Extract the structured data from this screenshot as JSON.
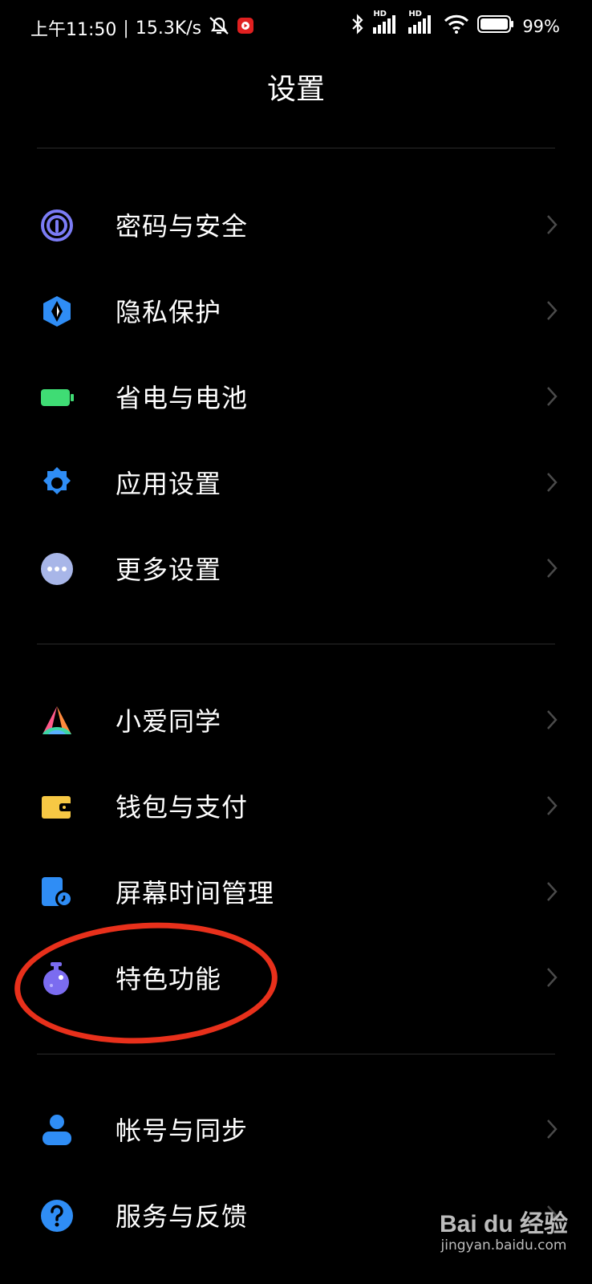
{
  "status_bar": {
    "time": "上午11:50",
    "speed": "15.3K/s",
    "battery": "99%",
    "hd1": "HD",
    "hd2": "HD",
    "icons": [
      "bell-muted-icon",
      "record-icon",
      "bluetooth-icon",
      "signal-icon",
      "signal-icon",
      "wifi-icon",
      "battery-icon"
    ]
  },
  "header": {
    "title": "设置"
  },
  "groups": [
    {
      "items": [
        {
          "label": "密码与安全",
          "icon": "fingerprint-icon",
          "color": "#7b7cf5"
        },
        {
          "label": "隐私保护",
          "icon": "privacy-shield-icon",
          "color": "#2f8df5"
        },
        {
          "label": "省电与电池",
          "icon": "battery-icon",
          "color": "#3fdc74"
        },
        {
          "label": "应用设置",
          "icon": "gear-icon",
          "color": "#2f8df5"
        },
        {
          "label": "更多设置",
          "icon": "more-dots-icon",
          "color": "#a8b6e8"
        }
      ]
    },
    {
      "items": [
        {
          "label": "小爱同学",
          "icon": "xiaoai-icon",
          "color": "#ff5a8a"
        },
        {
          "label": "钱包与支付",
          "icon": "wallet-icon",
          "color": "#f7c844"
        },
        {
          "label": "屏幕时间管理",
          "icon": "screen-time-icon",
          "color": "#2f8df5"
        },
        {
          "label": "特色功能",
          "icon": "flask-icon",
          "color": "#7b6cf0"
        }
      ]
    },
    {
      "items": [
        {
          "label": "帐号与同步",
          "icon": "account-icon",
          "color": "#2f8df5"
        },
        {
          "label": "服务与反馈",
          "icon": "help-icon",
          "color": "#2f8df5"
        }
      ]
    }
  ],
  "annotation": {
    "highlight_color": "#e8301b"
  },
  "watermark": {
    "brand": "Bai du 经验",
    "site": "jingyan.baidu.com"
  }
}
